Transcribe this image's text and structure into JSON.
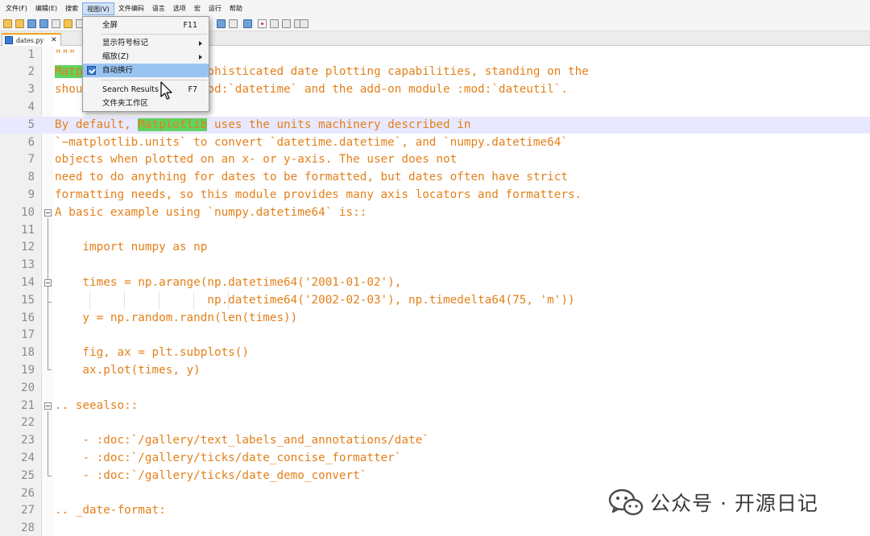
{
  "menubar": {
    "items": [
      "文件(F)",
      "编辑(E)",
      "搜索",
      "视图(V)",
      "文件编码",
      "语言",
      "选项",
      "宏",
      "运行",
      "帮助"
    ],
    "active_index": 3
  },
  "tab": {
    "filename": "dates.py",
    "close": "✕"
  },
  "view_menu": {
    "items": [
      {
        "label": "全屏",
        "shortcut": "F11"
      },
      {
        "label": "显示符号标记",
        "submenu": true
      },
      {
        "label": "缩放(Z)",
        "submenu": true
      },
      {
        "label": "自动换行",
        "checked": true,
        "selected": true
      },
      {
        "label": "Search Results",
        "shortcut": "F7"
      },
      {
        "label": "文件夹工作区"
      }
    ]
  },
  "editor": {
    "highlighted_line": 5,
    "lines": [
      {
        "n": "1",
        "segs": [
          {
            "t": "\"\"\""
          }
        ]
      },
      {
        "n": "2",
        "segs": [
          {
            "t": "Matplotlib",
            "hl": true
          },
          {
            "t": " provides sophisticated date plotting capabilities, standing on the"
          }
        ]
      },
      {
        "n": "3",
        "segs": [
          {
            "t": "shoulders of python :mod:`datetime` and the add-on module :mod:`dateutil`."
          }
        ]
      },
      {
        "n": "4",
        "segs": [
          {
            "t": ""
          }
        ]
      },
      {
        "n": "5",
        "segs": [
          {
            "t": "By default, "
          },
          {
            "t": "Matplotlib",
            "hl": true
          },
          {
            "t": " uses the units machinery described in"
          }
        ]
      },
      {
        "n": "6",
        "segs": [
          {
            "t": "`~matplotlib.units` to convert `datetime.datetime`, and `numpy.datetime64`"
          }
        ]
      },
      {
        "n": "7",
        "segs": [
          {
            "t": "objects when plotted on an x- or y-axis. The user does not"
          }
        ]
      },
      {
        "n": "8",
        "segs": [
          {
            "t": "need to do anything for dates to be formatted, but dates often have strict"
          }
        ]
      },
      {
        "n": "9",
        "segs": [
          {
            "t": "formatting needs, so this module provides many axis locators and formatters."
          }
        ]
      },
      {
        "n": "10",
        "segs": [
          {
            "t": "A basic example using `numpy.datetime64` is::"
          }
        ]
      },
      {
        "n": "11",
        "segs": [
          {
            "t": ""
          }
        ]
      },
      {
        "n": "12",
        "segs": [
          {
            "t": "    import numpy as np"
          }
        ]
      },
      {
        "n": "13",
        "segs": [
          {
            "t": ""
          }
        ]
      },
      {
        "n": "14",
        "segs": [
          {
            "t": "    times = np.arange(np.datetime64('2001-01-02'),"
          }
        ]
      },
      {
        "n": "15",
        "segs": [
          {
            "t": "                      np.datetime64('2002-02-03'), np.timedelta64(75, 'm'))"
          }
        ]
      },
      {
        "n": "16",
        "segs": [
          {
            "t": "    y = np.random.randn(len(times))"
          }
        ]
      },
      {
        "n": "17",
        "segs": [
          {
            "t": ""
          }
        ]
      },
      {
        "n": "18",
        "segs": [
          {
            "t": "    fig, ax = plt.subplots()"
          }
        ]
      },
      {
        "n": "19",
        "segs": [
          {
            "t": "    ax.plot(times, y)"
          }
        ]
      },
      {
        "n": "20",
        "segs": [
          {
            "t": ""
          }
        ]
      },
      {
        "n": "21",
        "segs": [
          {
            "t": ".. seealso::"
          }
        ]
      },
      {
        "n": "22",
        "segs": [
          {
            "t": ""
          }
        ]
      },
      {
        "n": "23",
        "segs": [
          {
            "t": "    - :doc:`/gallery/text_labels_and_annotations/date`"
          }
        ]
      },
      {
        "n": "24",
        "segs": [
          {
            "t": "    - :doc:`/gallery/ticks/date_concise_formatter`"
          }
        ]
      },
      {
        "n": "25",
        "segs": [
          {
            "t": "    - :doc:`/gallery/ticks/date_demo_convert`"
          }
        ]
      },
      {
        "n": "26",
        "segs": [
          {
            "t": ""
          }
        ]
      },
      {
        "n": "27",
        "segs": [
          {
            "t": ".. _date-format:"
          }
        ]
      },
      {
        "n": "28",
        "segs": [
          {
            "t": ""
          }
        ]
      }
    ]
  },
  "watermark": {
    "text": "公众号 · 开源日记",
    "icon": "wechat-icon"
  },
  "colors": {
    "code_text": "#e3801a",
    "word_highlight": "#5fd35f",
    "line_highlight": "#e8e8ff",
    "menu_selection": "#99c4f2",
    "tab_accent": "#f4a31c"
  }
}
